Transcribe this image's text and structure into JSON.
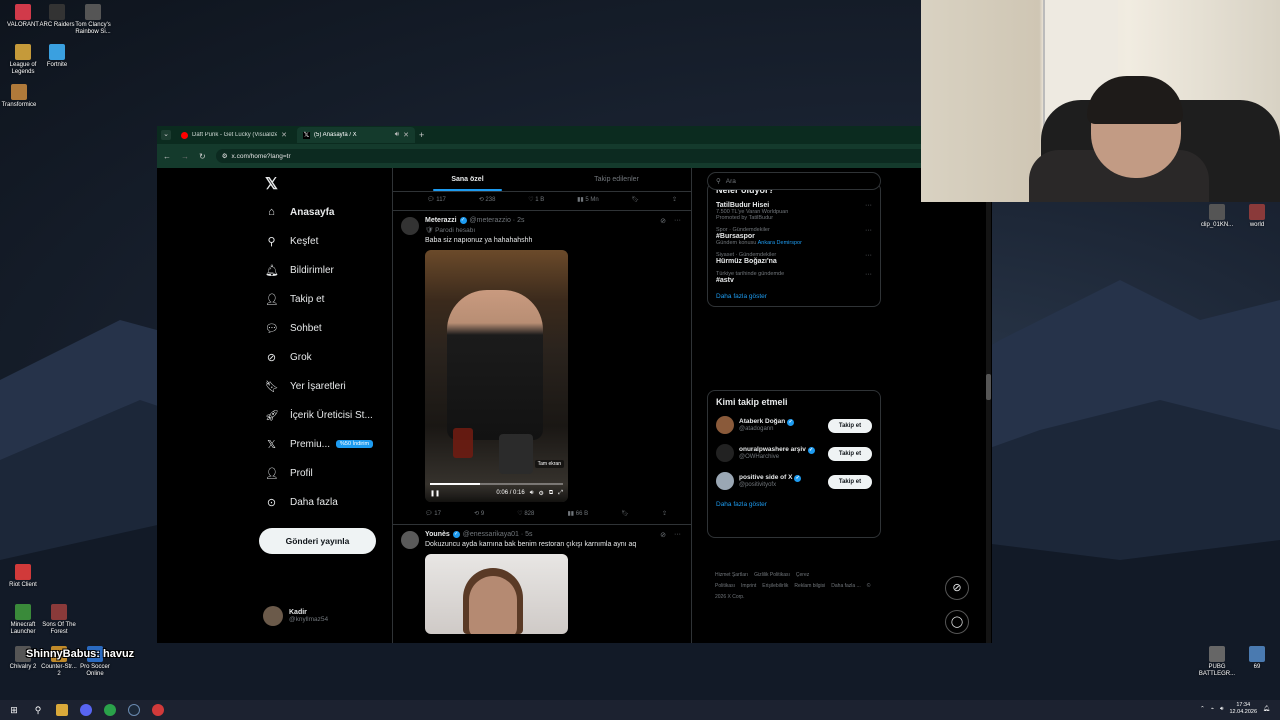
{
  "desktop": {
    "icons_left": [
      {
        "label": "VALORANT",
        "color": "#d13a4a"
      },
      {
        "label": "ARC Raiders",
        "color": "#333333"
      },
      {
        "label": "Tom Clancy's Rainbow Si...",
        "color": "#555555"
      },
      {
        "label": "League of Legends",
        "color": "#c59a3a"
      },
      {
        "label": "Fortnite",
        "color": "#3aa0e0"
      },
      {
        "label": "Transformice",
        "color": "#b07a3a"
      },
      {
        "label": "Riot Client",
        "color": "#d13a3a"
      },
      {
        "label": "Minecraft Launcher",
        "color": "#3a8a3a"
      },
      {
        "label": "Sons Of The Forest",
        "color": "#8a3a3a"
      },
      {
        "label": "Chivalry 2",
        "color": "#555555"
      },
      {
        "label": "Counter-Str... 2",
        "color": "#c08a2a"
      },
      {
        "label": "Pro Soccer Online",
        "color": "#2a6ac0"
      }
    ],
    "icons_right": [
      {
        "label": "clip_01KN...",
        "color": "#555555"
      },
      {
        "label": "world",
        "color": "#8a3a3a"
      },
      {
        "label": "PUBG BATTLEGR...",
        "color": "#666666"
      },
      {
        "label": "69",
        "color": "#4a7ab0"
      }
    ],
    "overlay_text": "ShinnyBabus: havuz"
  },
  "browser": {
    "tabs": [
      {
        "title": "Daft Punk - Get Lucky (Visualize...",
        "favicon_color": "#ff0000",
        "active": false
      },
      {
        "title": "(5) Anasayfa / X",
        "favicon_color": "#ffffff",
        "active": true
      }
    ],
    "new_tab": "+",
    "url": "x.com/home?lang=tr"
  },
  "x": {
    "nav": [
      {
        "label": "Anasayfa",
        "icon": "home-icon",
        "glyph": "⌂",
        "active": true
      },
      {
        "label": "Keşfet",
        "icon": "search-icon",
        "glyph": "⚲"
      },
      {
        "label": "Bildirimler",
        "icon": "bell-icon",
        "glyph": "🔔︎"
      },
      {
        "label": "Takip et",
        "icon": "add-user-icon",
        "glyph": "👤︎"
      },
      {
        "label": "Sohbet",
        "icon": "chat-icon",
        "glyph": "💬︎"
      },
      {
        "label": "Grok",
        "icon": "grok-icon",
        "glyph": "⊘"
      },
      {
        "label": "Yer İşaretleri",
        "icon": "bookmark-icon",
        "glyph": "🔖︎"
      },
      {
        "label": "İçerik Üreticisi St...",
        "icon": "rocket-icon",
        "glyph": "🚀︎"
      },
      {
        "label": "Premiu...",
        "icon": "x-icon",
        "glyph": "𝕏",
        "badge": "%50 İndirim"
      },
      {
        "label": "Profil",
        "icon": "profile-icon",
        "glyph": "👤︎"
      },
      {
        "label": "Daha fazla",
        "icon": "more-circle-icon",
        "glyph": "⊙"
      }
    ],
    "post_button": "Gönderi yayınla",
    "account": {
      "name": "Kadir",
      "handle": "@knyllmaz54",
      "more": "•••"
    },
    "timeline_tabs": [
      "Sana özel",
      "Takip edilenler"
    ],
    "prev_actions": {
      "replies": "117",
      "reposts": "238",
      "likes": "1 B",
      "views": "5 Mn"
    },
    "posts": [
      {
        "name": "Meterazzi",
        "handle": "@meterazzio · 2s",
        "parody": "Parodi hesabı",
        "text": "Baba siz napıonuz ya hahahahshh",
        "video": {
          "time": "0:06 / 0:16",
          "progress": 0.375,
          "fullscreen_tip": "Tam ekran"
        },
        "actions": {
          "replies": "17",
          "reposts": "9",
          "likes": "828",
          "views": "66 B"
        }
      },
      {
        "name": "Younès",
        "handle": "@enessarikaya01 · 5s",
        "text": "Dokuzuncu ayda karnına bak benim restoran çıkışı karnımla aynı aq"
      }
    ],
    "search_placeholder": "Ara",
    "trends_title": "Neler oluyor?",
    "trends": [
      {
        "meta": "",
        "name": "TatilBudur Hisei",
        "sub": "7.500 TL'ye Varan Worldpuan",
        "sub2": "Promoted by TatilBudur"
      },
      {
        "meta": "Spor · Gündemdekiler",
        "name": "#Bursaspor",
        "sub": "Gündem konusu",
        "link": "Ankara Demirspor"
      },
      {
        "meta": "Siyaset · Gündemdekiler",
        "name": "Hürmüz Boğazı'na",
        "sub": ""
      },
      {
        "meta": "Türkiye tarihinde gündemde",
        "name": "#astv",
        "sub": ""
      }
    ],
    "trends_more": "Daha fazla göster",
    "who_title": "Kimi takip etmeli",
    "who": [
      {
        "name": "Ataberk Doğan",
        "handle": "@atadogann",
        "button": "Takip et",
        "color": "#8a5a3a"
      },
      {
        "name": "onuralpwashere arşiv",
        "handle": "@OWHarchive",
        "button": "Takip et",
        "color": "#222222"
      },
      {
        "name": "positive side of X",
        "handle": "@positivityofx",
        "button": "Takip et",
        "color": "#9aa7b4"
      }
    ],
    "who_more": "Daha fazla göster",
    "footer": [
      "Hizmet Şartları",
      "Gizlilik Politikası",
      "Çerez Politikası",
      "Imprint",
      "Erişilebilirlik",
      "Reklam bilgisi",
      "Daha fazla ...",
      "© 2026 X Corp."
    ]
  },
  "taskbar": {
    "time": "17:34",
    "date": "12.04.2026"
  }
}
